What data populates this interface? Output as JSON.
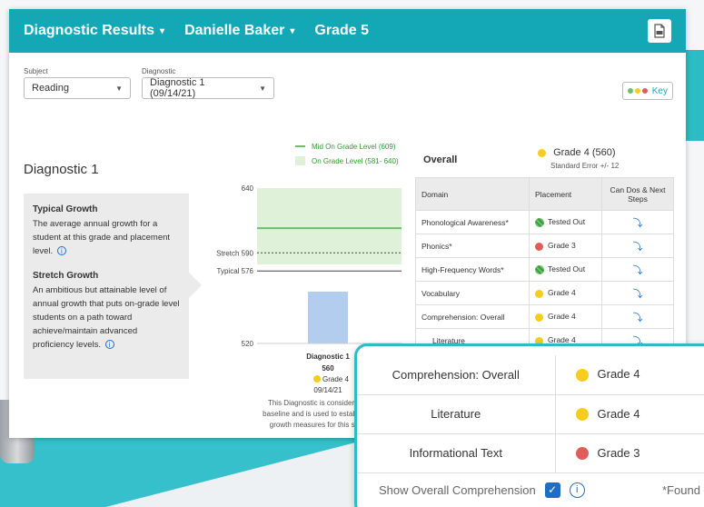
{
  "header": {
    "crumbs": [
      {
        "label": "Diagnostic Results",
        "dropdown": true
      },
      {
        "label": "Danielle Baker",
        "dropdown": true
      },
      {
        "label": "Grade 5",
        "dropdown": false
      }
    ],
    "pdf_icon": "pdf-file-icon"
  },
  "filters": {
    "subject": {
      "label": "Subject",
      "value": "Reading"
    },
    "diagnostic": {
      "label": "Diagnostic",
      "value": "Diagnostic 1 (09/14/21)"
    }
  },
  "key_button": {
    "label": "Key"
  },
  "diagnostic_title": "Diagnostic 1",
  "info": {
    "typical_title": "Typical Growth",
    "typical_text": "The average annual growth for a student at this grade and placement level.",
    "stretch_title": "Stretch Growth",
    "stretch_text": "An ambitious but attainable level of annual growth that puts on-grade level students on a path toward achieve/maintain advanced proficiency levels."
  },
  "chart_data": {
    "type": "bar",
    "ylim": [
      520,
      640
    ],
    "y_ticks": [
      "640",
      "520"
    ],
    "legend": [
      {
        "label": "Mid On Grade Level (609)",
        "kind": "line"
      },
      {
        "label": "On Grade Level (581- 640)",
        "kind": "band"
      }
    ],
    "on_grade_band": [
      581,
      640
    ],
    "mid_on_grade": 609,
    "reference_lines": [
      {
        "label": "Stretch 590",
        "value": 590,
        "style": "dashed"
      },
      {
        "label": "Typical 576",
        "value": 576,
        "style": "solid"
      }
    ],
    "bars": [
      {
        "category": "Diagnostic 1",
        "value": 560,
        "value_label": "560",
        "placement": "Grade 4",
        "date": "09/14/21"
      }
    ],
    "colors": {
      "bar": "#b3cdee",
      "band": "#dff1d9",
      "mid_line": "#6cc06c",
      "placement_dot": "#f5cd1a"
    }
  },
  "footnote": "This Diagnostic is considered baseline and is used to establish growth measures for this s...",
  "overall": {
    "label": "Overall",
    "placement": "Grade 4 (560)",
    "std_error": "Standard Error +/- 12"
  },
  "domain_table": {
    "headers": [
      "Domain",
      "Placement",
      "Can Dos & Next Steps"
    ],
    "rows": [
      {
        "domain": "Phonological Awareness*",
        "placement": "Tested Out",
        "status": "tested-out"
      },
      {
        "domain": "Phonics*",
        "placement": "Grade 3",
        "status": "red"
      },
      {
        "domain": "High-Frequency Words*",
        "placement": "Tested Out",
        "status": "tested-out"
      },
      {
        "domain": "Vocabulary",
        "placement": "Grade 4",
        "status": "yellow"
      },
      {
        "domain": "Comprehension: Overall",
        "placement": "Grade 4",
        "status": "yellow"
      },
      {
        "domain": "Literature",
        "placement": "Grade 4",
        "status": "yellow"
      }
    ]
  },
  "zoom": {
    "rows": [
      {
        "domain": "Comprehension: Overall",
        "placement": "Grade 4",
        "status": "yellow"
      },
      {
        "domain": "Literature",
        "placement": "Grade 4",
        "status": "yellow"
      },
      {
        "domain": "Informational Text",
        "placement": "Grade 3",
        "status": "red"
      }
    ],
    "show_label": "Show Overall Comprehension",
    "found_text": "*Found"
  },
  "colors": {
    "brand": "#14a8b7",
    "yellow": "#f5cd1a",
    "red": "#e25a5a",
    "green": "#3c9a3c",
    "link": "#1c6fc4"
  }
}
